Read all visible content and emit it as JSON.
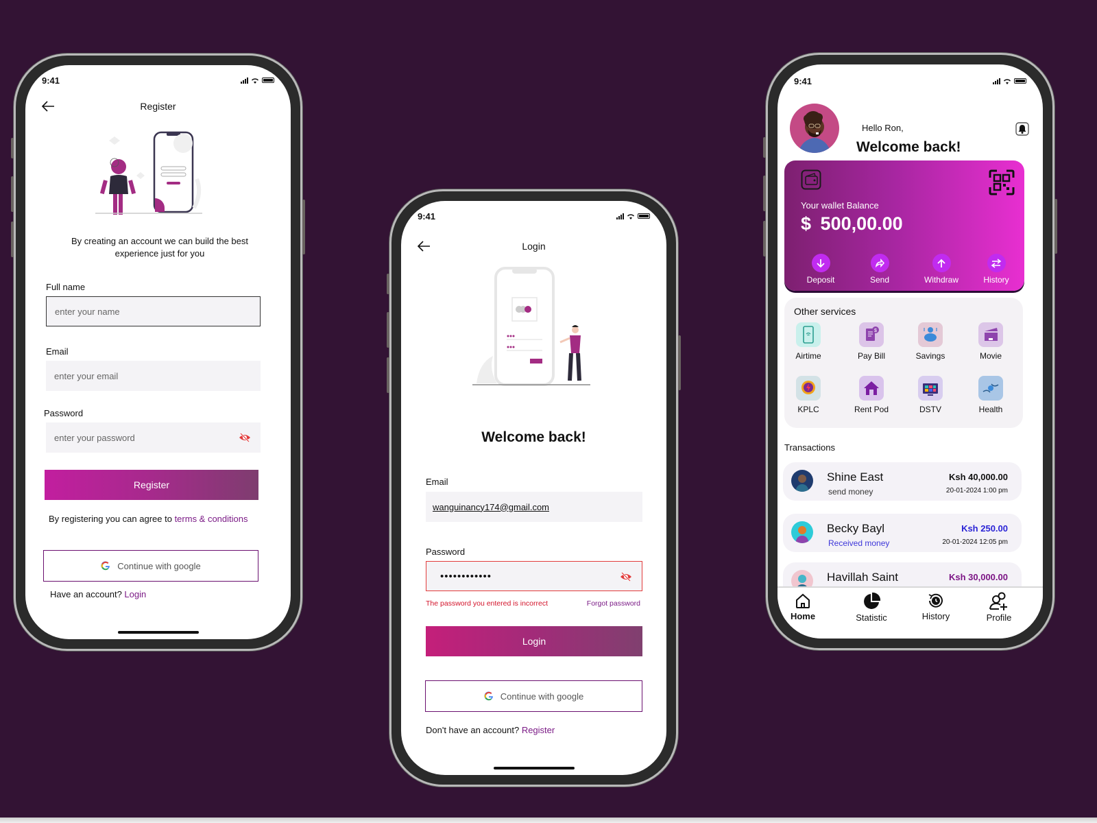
{
  "status_bar": {
    "time": "9:41"
  },
  "register_screen": {
    "title": "Register",
    "tagline": "By creating an account we can build the best experience just for you",
    "fields": [
      {
        "label": "Full name",
        "placeholder": "enter your name",
        "value": ""
      },
      {
        "label": "Email",
        "placeholder": "enter your email",
        "value": ""
      },
      {
        "label": "Password",
        "placeholder": "enter your password",
        "value": ""
      }
    ],
    "register_button": "Register",
    "terms_prefix": "By registering you can agree to ",
    "terms_link": "terms & conditions",
    "google_button": "Continue with google",
    "account_prompt": "Have an account? ",
    "login_link": "Login"
  },
  "login_screen": {
    "title": "Login",
    "heading": "Welcome back!",
    "email_label": "Email",
    "email_value": "wanguinancy174@gmail.com",
    "password_label": "Password",
    "password_value": "••••••••••••",
    "error_message": "The password you entered is incorrect",
    "forgot_link": "Forgot password",
    "login_button": "Login",
    "google_button": "Continue with google",
    "account_prompt": "Don't have an account? ",
    "register_link": "Register"
  },
  "dashboard_screen": {
    "greeting": "Hello Ron,",
    "heading": "Welcome back!",
    "wallet": {
      "label": "Your wallet Balance",
      "currency": "$",
      "amount": "500,00.00",
      "actions": [
        {
          "label": "Deposit",
          "icon": "arrow-down-icon"
        },
        {
          "label": "Send",
          "icon": "share-icon"
        },
        {
          "label": "Withdraw",
          "icon": "arrow-up-icon"
        },
        {
          "label": "History",
          "icon": "swap-icon"
        }
      ]
    },
    "services_title": "Other services",
    "services": [
      {
        "label": "Airtime",
        "icon": "phone-wifi-icon",
        "bg": "#c9f0ec"
      },
      {
        "label": "Pay Bill",
        "icon": "bill-icon",
        "bg": "#dcc4e8"
      },
      {
        "label": "Savings",
        "icon": "piggy-bank-icon",
        "bg": "#e4c9d6"
      },
      {
        "label": "Movie",
        "icon": "clapperboard-icon",
        "bg": "#dcc6e8"
      },
      {
        "label": "KPLC",
        "icon": "bulb-icon",
        "bg": "#d3e2e6"
      },
      {
        "label": "Rent Pod",
        "icon": "house-icon",
        "bg": "#d9c3ec"
      },
      {
        "label": "DSTV",
        "icon": "tv-icon",
        "bg": "#d8cdef"
      },
      {
        "label": "Health",
        "icon": "health-hands-icon",
        "bg": "#a9c6e6"
      }
    ],
    "transactions_title": "Transactions",
    "transactions": [
      {
        "name": "Shine East",
        "type": "send money",
        "amount": "Ksh 40,000.00",
        "date": "20-01-2024 1:00 pm",
        "amount_color": "#111111",
        "type_color": "#333333"
      },
      {
        "name": "Becky  Bayl",
        "type": "Received money",
        "amount": "Ksh 250.00",
        "date": "20-01-2024 12:05 pm",
        "amount_color": "#2b24d6",
        "type_color": "#3d36d9"
      },
      {
        "name": "Havillah Saint",
        "type": "",
        "amount": "Ksh 30,000.00",
        "date": "",
        "amount_color": "#7c1585",
        "type_color": "#333333"
      }
    ],
    "tabs": [
      {
        "label": "Home",
        "active": true
      },
      {
        "label": "Statistic",
        "active": false
      },
      {
        "label": "History",
        "active": false
      },
      {
        "label": "Profile",
        "active": false
      }
    ]
  },
  "colors": {
    "background": "#331334",
    "brand_purple": "#7b1b86",
    "error_red": "#e23b3b"
  }
}
